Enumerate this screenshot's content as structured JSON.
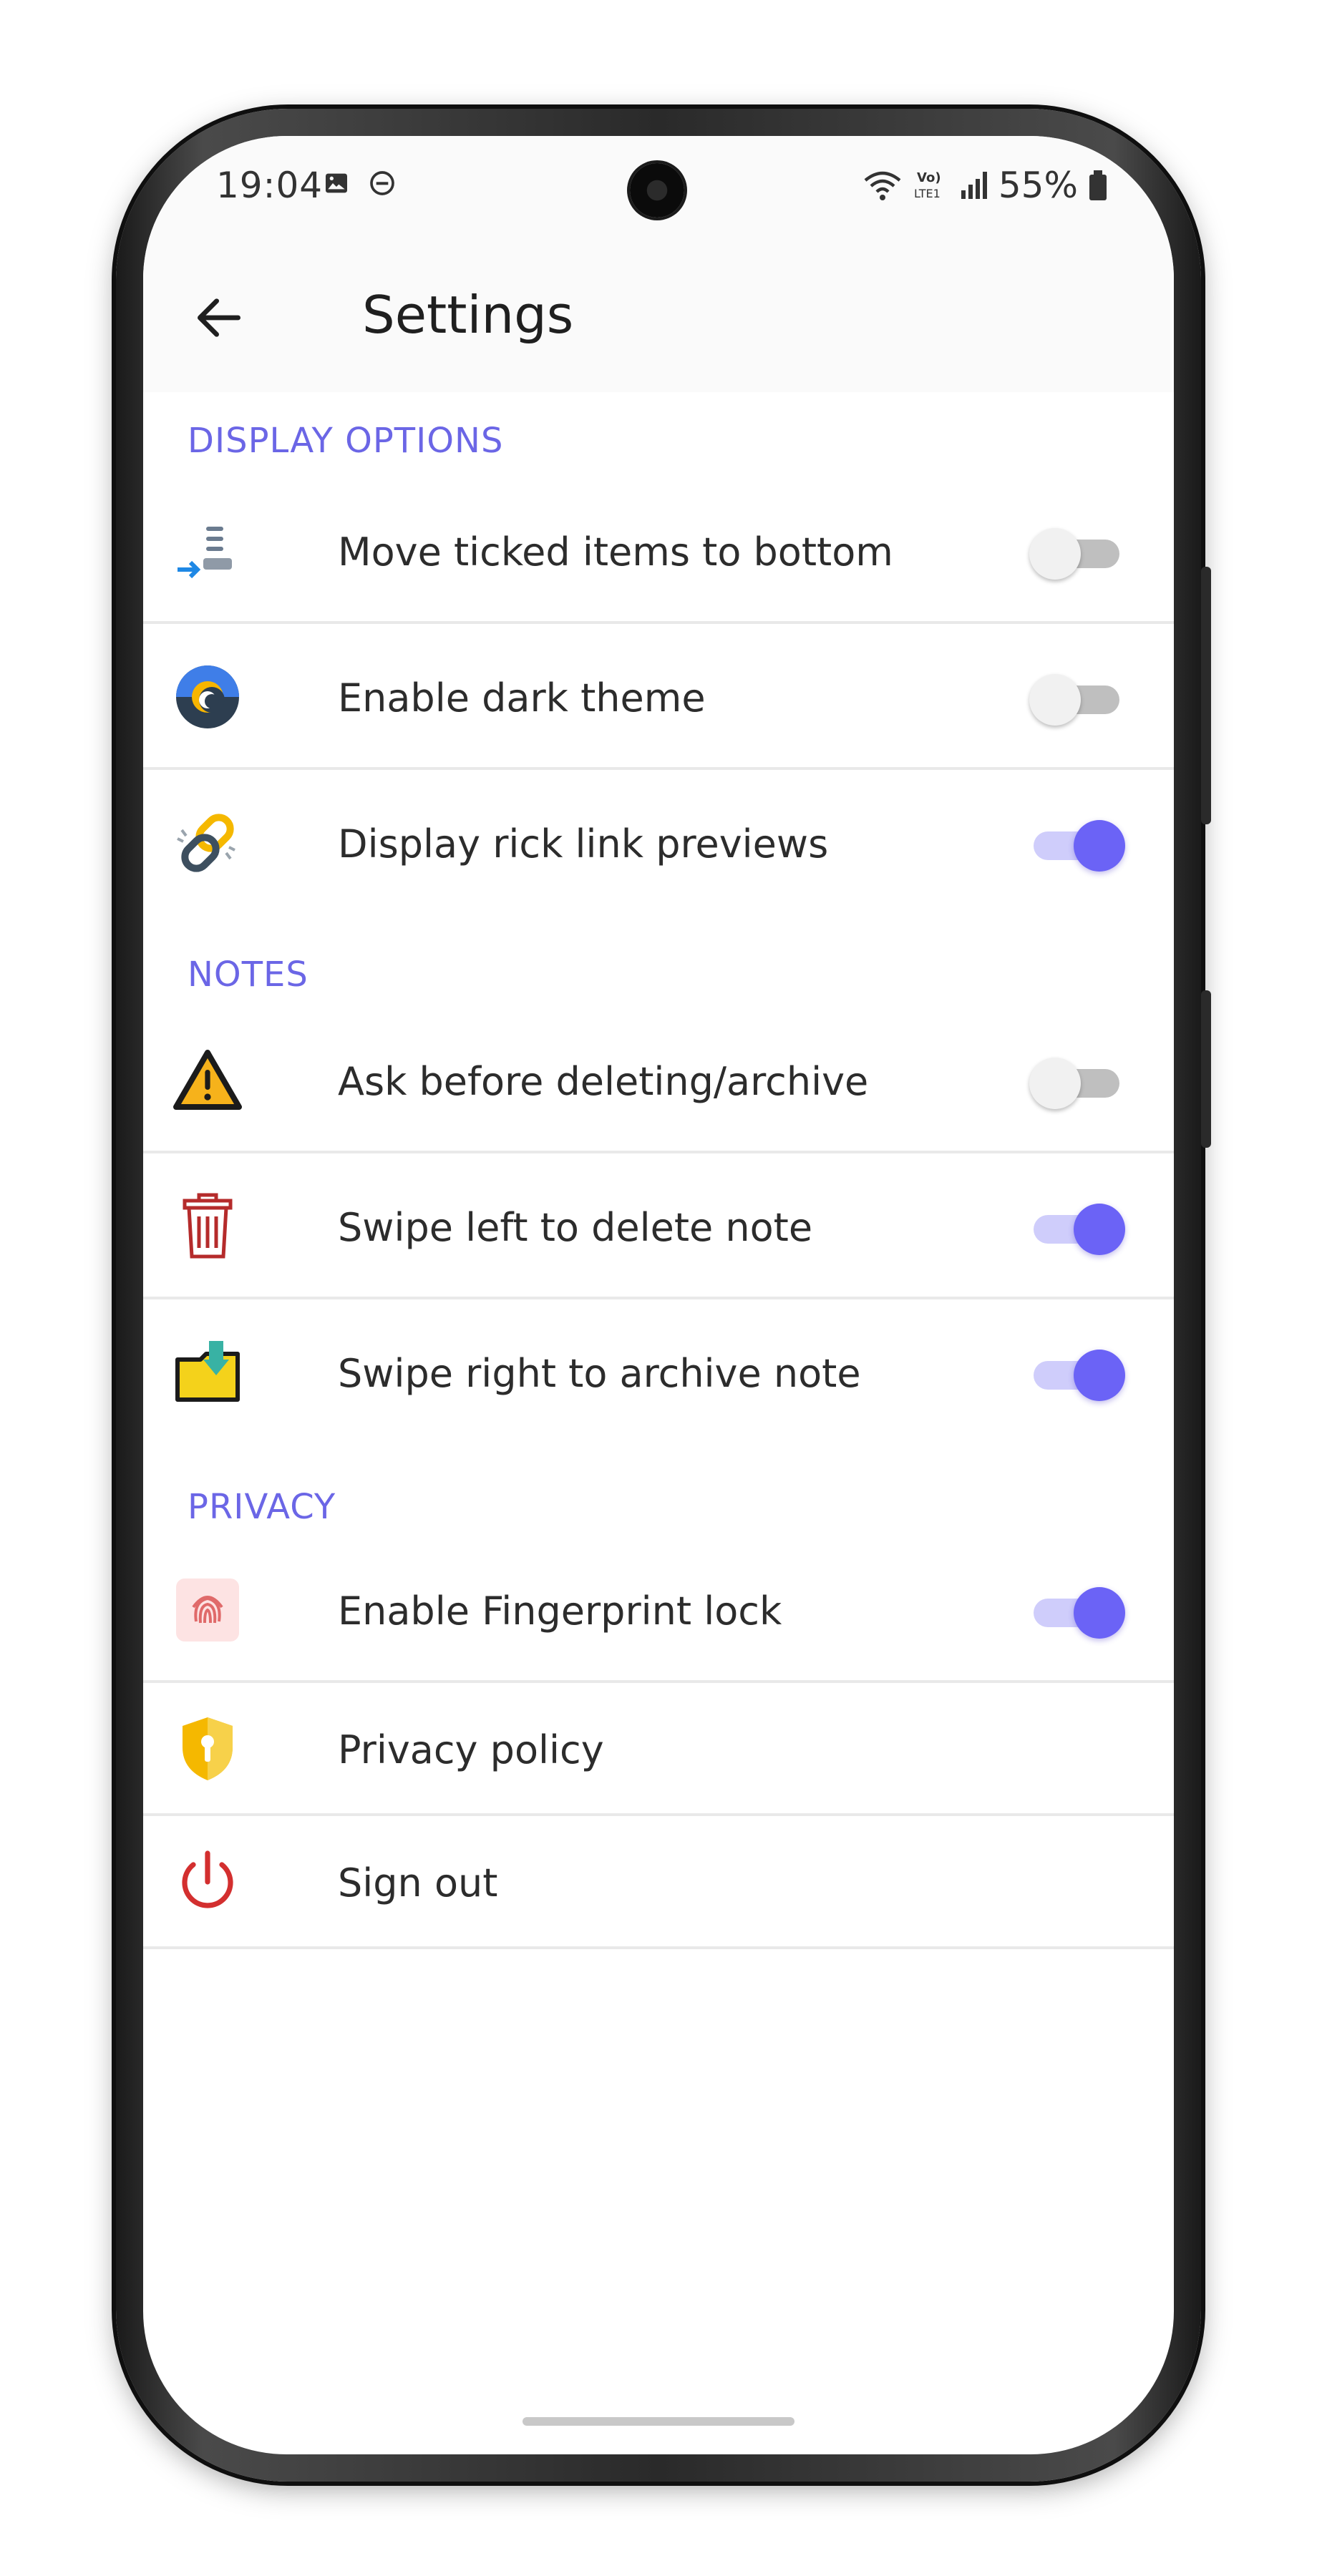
{
  "status_bar": {
    "time": "19:04",
    "battery": "55%",
    "left_icons": [
      "gallery-icon",
      "dnd-icon"
    ],
    "right_icons": [
      "wifi-icon",
      "volte-icon",
      "signal-icon",
      "battery-icon"
    ]
  },
  "app_bar": {
    "back_icon": "arrow-left-icon",
    "title": "Settings"
  },
  "colors": {
    "accent": "#6b63f6",
    "section_header": "#6b66e6",
    "toggle_off_track": "#bfbfbf",
    "toggle_on_track": "#cfcdfb"
  },
  "sections": [
    {
      "header": "DISPLAY OPTIONS",
      "items": [
        {
          "label": "Move ticked items to bottom",
          "icon": "move-to-bottom-icon",
          "toggle": false
        },
        {
          "label": "Enable dark theme",
          "icon": "dark-theme-icon",
          "toggle": false
        },
        {
          "label": "Display rick link previews",
          "icon": "link-icon",
          "toggle": true
        }
      ]
    },
    {
      "header": "NOTES",
      "items": [
        {
          "label": "Ask before deleting/archive",
          "icon": "warning-icon",
          "toggle": false
        },
        {
          "label": "Swipe left to delete note",
          "icon": "trash-icon",
          "toggle": true
        },
        {
          "label": "Swipe right to archive note",
          "icon": "archive-icon",
          "toggle": true
        }
      ]
    },
    {
      "header": "PRIVACY",
      "items": [
        {
          "label": "Enable Fingerprint lock",
          "icon": "fingerprint-icon",
          "toggle": true
        },
        {
          "label": "Privacy policy",
          "icon": "shield-icon"
        },
        {
          "label": "Sign out",
          "icon": "power-icon"
        }
      ]
    }
  ]
}
